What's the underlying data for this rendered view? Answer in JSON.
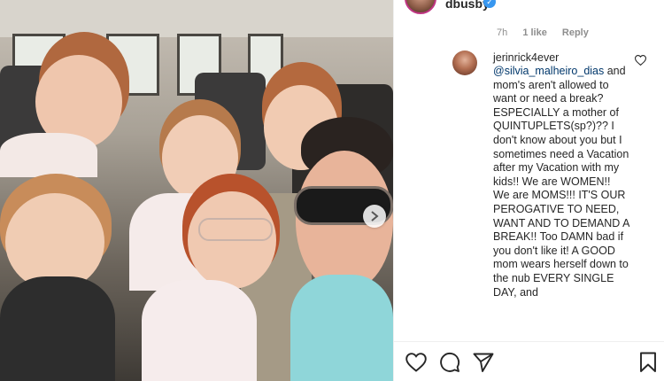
{
  "post": {
    "username": "dbusby"
  },
  "meta": {
    "time": "7h",
    "likes": "1 like",
    "reply": "Reply"
  },
  "comment": {
    "username": "jerinrick4ever",
    "mention": "@silvia_malheiro_dias",
    "text": "and mom's aren't allowed to want or need a break? ESPECIALLY a mother of QUINTUPLETS(sp?)?? I don't know about you but I sometimes need a Vacation after my Vacation with my kids!! We are WOMEN!! We are MOMS!!! IT'S OUR PEROGATIVE TO NEED, WANT AND TO DEMAND A BREAK!! Too DAMN bad if you don't like it! A GOOD mom wears herself down to the nub EVERY SINGLE DAY, and"
  },
  "icons": {
    "like": "heart-icon",
    "comment": "comment-icon",
    "share": "send-icon",
    "save": "bookmark-icon",
    "next": "chevron-right-icon",
    "verified": "verified-badge-icon"
  },
  "colors": {
    "verified": "#3897f0",
    "mention": "#00376b",
    "story_ring": "#c13584"
  }
}
